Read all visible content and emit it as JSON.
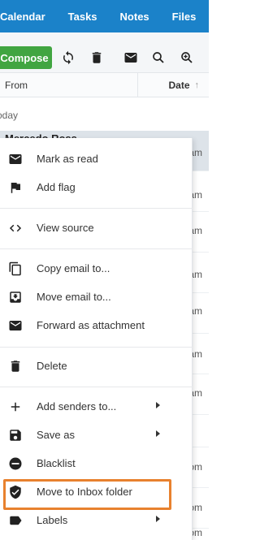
{
  "topnav": {
    "items": [
      "Calendar",
      "Tasks",
      "Notes",
      "Files"
    ]
  },
  "toolbar": {
    "compose_label": "Compose",
    "icons": [
      "refresh-icon",
      "trash-icon",
      "mail-icon",
      "search-icon",
      "zoom-in-icon"
    ]
  },
  "list_header": {
    "from_label": "From",
    "date_label": "Date",
    "sort_arrow": "↑"
  },
  "group": {
    "label": "oday"
  },
  "messages": {
    "first_sender": "Mercedo Ross",
    "times": [
      "am",
      "am",
      "am",
      "am",
      "am",
      "am",
      "am",
      "am",
      "om",
      "om",
      "om"
    ]
  },
  "menu": {
    "mark_read": "Mark as read",
    "add_flag": "Add flag",
    "view_source": "View source",
    "copy_email": "Copy email to...",
    "move_email": "Move email to...",
    "forward_attachment": "Forward as attachment",
    "delete": "Delete",
    "add_senders": "Add senders to...",
    "save_as": "Save as",
    "blacklist": "Blacklist",
    "move_inbox": "Move to Inbox folder",
    "labels": "Labels"
  },
  "colors": {
    "nav_bg": "#1b82c9",
    "compose_bg": "#41a541",
    "highlight_border": "#e8812e"
  }
}
